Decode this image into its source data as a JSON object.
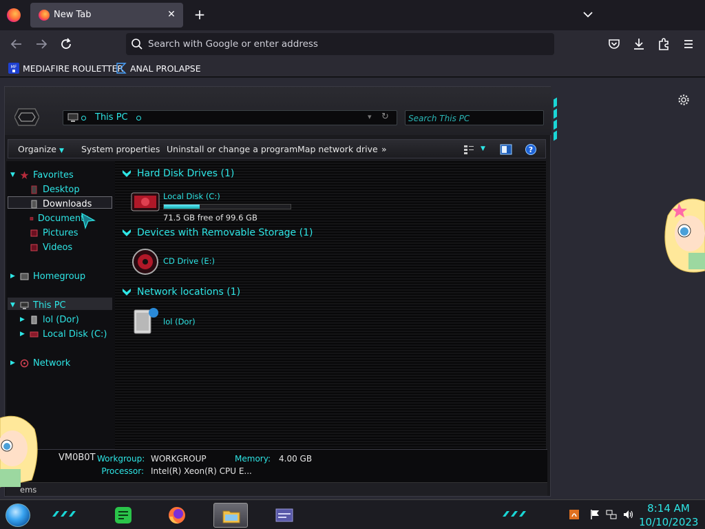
{
  "browser": {
    "tab": {
      "title": "New Tab",
      "close_icon": "close-icon"
    },
    "urlbar": {
      "placeholder": "Search with Google or enter address"
    },
    "bookmarks": [
      {
        "label": "MEDIAFIRE ROULETTER",
        "icon": "mediafire-icon",
        "icon_text": "MF"
      },
      {
        "label": "ANAL PROLAPSE",
        "icon": "sigma-icon"
      }
    ]
  },
  "explorer": {
    "address": {
      "crumb": "This PC"
    },
    "search": {
      "placeholder": "Search This PC"
    },
    "commands": {
      "organize": "Organize",
      "system_properties": "System properties",
      "uninstall": "Uninstall or change a program",
      "map_drive": "Map network drive",
      "more": "»"
    },
    "nav": {
      "favorites": "Favorites",
      "desktop": "Desktop",
      "downloads": "Downloads",
      "documents": "Documents",
      "pictures": "Pictures",
      "videos": "Videos",
      "homegroup": "Homegroup",
      "this_pc": "This PC",
      "lol_dor": "lol (Dor)",
      "local_disk": "Local Disk (C:)",
      "network": "Network"
    },
    "groups": {
      "hdd": {
        "title": "Hard Disk Drives (1)",
        "items": [
          {
            "name": "Local Disk (C:)",
            "free_text": "71.5 GB free of 99.6 GB",
            "used_fraction": 0.28
          }
        ]
      },
      "removable": {
        "title": "Devices with Removable Storage (1)",
        "items": [
          {
            "name": "CD Drive (E:)"
          }
        ]
      },
      "network": {
        "title": "Network locations (1)",
        "items": [
          {
            "name": "lol (Dor)"
          }
        ]
      }
    },
    "details": {
      "host": "VM0B0T",
      "workgroup_label": "Workgroup:",
      "workgroup_value": "WORKGROUP",
      "memory_label": "Memory:",
      "memory_value": "4.00 GB",
      "processor_label": "Processor:",
      "processor_value": "Intel(R) Xeon(R) CPU E..."
    },
    "status": {
      "text": "ems"
    }
  },
  "taskbar": {
    "clock": {
      "time": "8:14 AM",
      "date": "10/10/2023"
    }
  },
  "colors": {
    "accent": "#2ee6e6",
    "browser_bg": "#1c1b22",
    "toolbar_bg": "#2b2a33"
  }
}
